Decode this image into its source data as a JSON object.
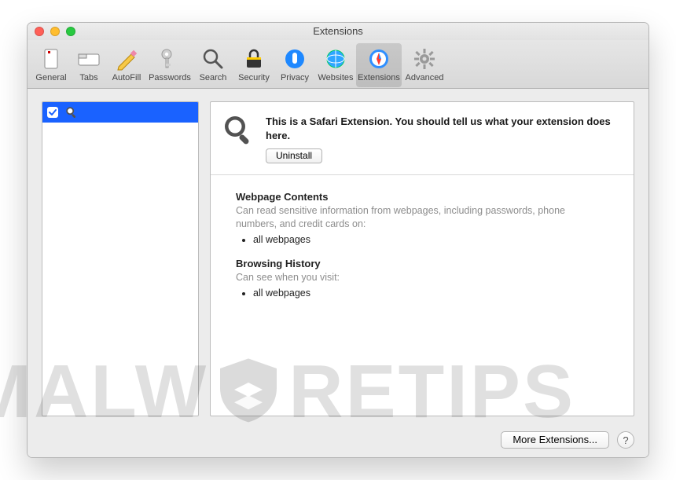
{
  "window": {
    "title": "Extensions"
  },
  "toolbar": {
    "items": [
      {
        "label": "General"
      },
      {
        "label": "Tabs"
      },
      {
        "label": "AutoFill"
      },
      {
        "label": "Passwords"
      },
      {
        "label": "Search"
      },
      {
        "label": "Security"
      },
      {
        "label": "Privacy"
      },
      {
        "label": "Websites"
      },
      {
        "label": "Extensions"
      },
      {
        "label": "Advanced"
      }
    ]
  },
  "sidebar": {
    "items": [
      {
        "enabled": true
      }
    ]
  },
  "detail": {
    "description": "This is a Safari Extension. You should tell us what your extension does here.",
    "uninstall_label": "Uninstall",
    "perm1_title": "Webpage Contents",
    "perm1_desc": "Can read sensitive information from webpages, including passwords, phone numbers, and credit cards on:",
    "perm1_item1": "all webpages",
    "perm2_title": "Browsing History",
    "perm2_desc": "Can see when you visit:",
    "perm2_item1": "all webpages"
  },
  "footer": {
    "more_label": "More Extensions...",
    "help": "?"
  },
  "watermark": {
    "left": "MALW",
    "right": "RETIPS"
  }
}
